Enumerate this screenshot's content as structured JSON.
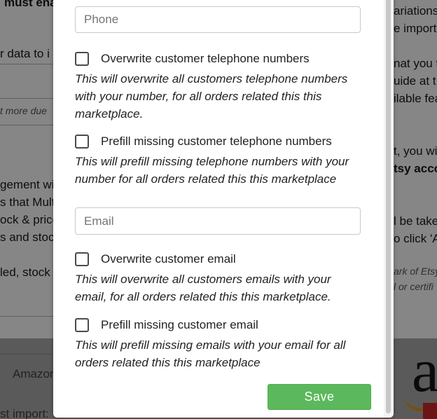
{
  "background": {
    "left_texts": [
      "must ena",
      "r data to i",
      "t more due",
      "gement wil",
      "s that Mult",
      "ock & price",
      "s and stoc",
      "led, stock"
    ],
    "right_texts": [
      "ariations",
      "e importe",
      "nat you t",
      "uide at t",
      "ilable fea",
      "t, you wi",
      "tsy acco",
      "l be take",
      "o click 'A",
      "ark of Etsy",
      "l or certifi"
    ],
    "strip_texts": [
      "Amazon",
      "st import:"
    ]
  },
  "modal": {
    "phone_placeholder": "Phone",
    "overwrite_phone_label": "Overwrite customer telephone numbers",
    "overwrite_phone_help": "This will overwrite all customers telephone numbers with your number, for all orders related this this marketplace.",
    "prefill_phone_label": "Prefill missing customer telephone numbers",
    "prefill_phone_help": "This will prefill missing telephone numbers with your number for all orders related this this marketplace",
    "email_placeholder": "Email",
    "overwrite_email_label": "Overwrite customer email",
    "overwrite_email_help": "This will overwrite all customers emails with your email, for all orders related this this marketplace.",
    "prefill_email_label": "Prefill missing customer email",
    "prefill_email_help": "This will prefill missing emails with your email for all orders related this this marketplace",
    "save_label": "Save"
  },
  "colors": {
    "save_button": "#5cb85c",
    "overlay": "#868686"
  }
}
